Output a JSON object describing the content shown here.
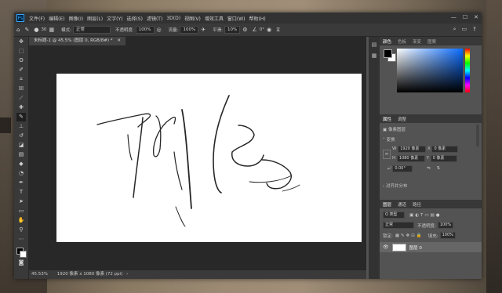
{
  "menu": [
    "文件(F)",
    "编辑(E)",
    "图像(I)",
    "图层(L)",
    "文字(Y)",
    "选择(S)",
    "滤镜(T)",
    "3D(D)",
    "视图(V)",
    "增效工具",
    "窗口(W)",
    "帮助(H)"
  ],
  "app_logo": "Ps",
  "window_controls": [
    "—",
    "☐",
    "✕"
  ],
  "options": {
    "brush_size": "30",
    "mode_label": "模式:",
    "mode_value": "正常",
    "opacity_label": "不透明度:",
    "opacity_value": "100%",
    "flow_label": "流量:",
    "flow_value": "100%",
    "smooth_label": "平滑:",
    "smooth_value": "10%",
    "angle_value": "0°"
  },
  "document": {
    "tab_title": "未标题-1 @ 45.5% (图层 0, RGB/8#) *",
    "zoom": "45.53%",
    "size_info": "1920 像素 x 1080 像素 (72 ppi)"
  },
  "tools": [
    "move",
    "marquee",
    "lasso",
    "quick-select",
    "crop",
    "frame",
    "eyedropper",
    "healing",
    "brush",
    "stamp",
    "history-brush",
    "eraser",
    "gradient",
    "blur",
    "dodge",
    "pen",
    "type",
    "path-select",
    "shape",
    "hand",
    "zoom",
    "more"
  ],
  "color_panel": {
    "tabs": [
      "颜色",
      "色板",
      "渐变",
      "图案"
    ]
  },
  "properties": {
    "tabs": [
      "属性",
      "调整"
    ],
    "pixel_layer": "像素图层",
    "transform_label": "变换",
    "w_label": "W",
    "w_value": "1920 像素",
    "h_label": "H",
    "h_value": "1080 像素",
    "x_label": "X",
    "x_value": "0 像素",
    "y_label": "Y",
    "y_value": "0 像素",
    "angle_value": "0.00°",
    "align_label": "对齐并分布"
  },
  "layers": {
    "tabs": [
      "图层",
      "通道",
      "路径"
    ],
    "filter_label": "Q 类型",
    "blend_mode": "正常",
    "opacity_label": "不透明度:",
    "opacity_value": "100%",
    "lock_label": "锁定:",
    "fill_label": "填充:",
    "fill_value": "100%",
    "layer_name": "图层 0"
  }
}
